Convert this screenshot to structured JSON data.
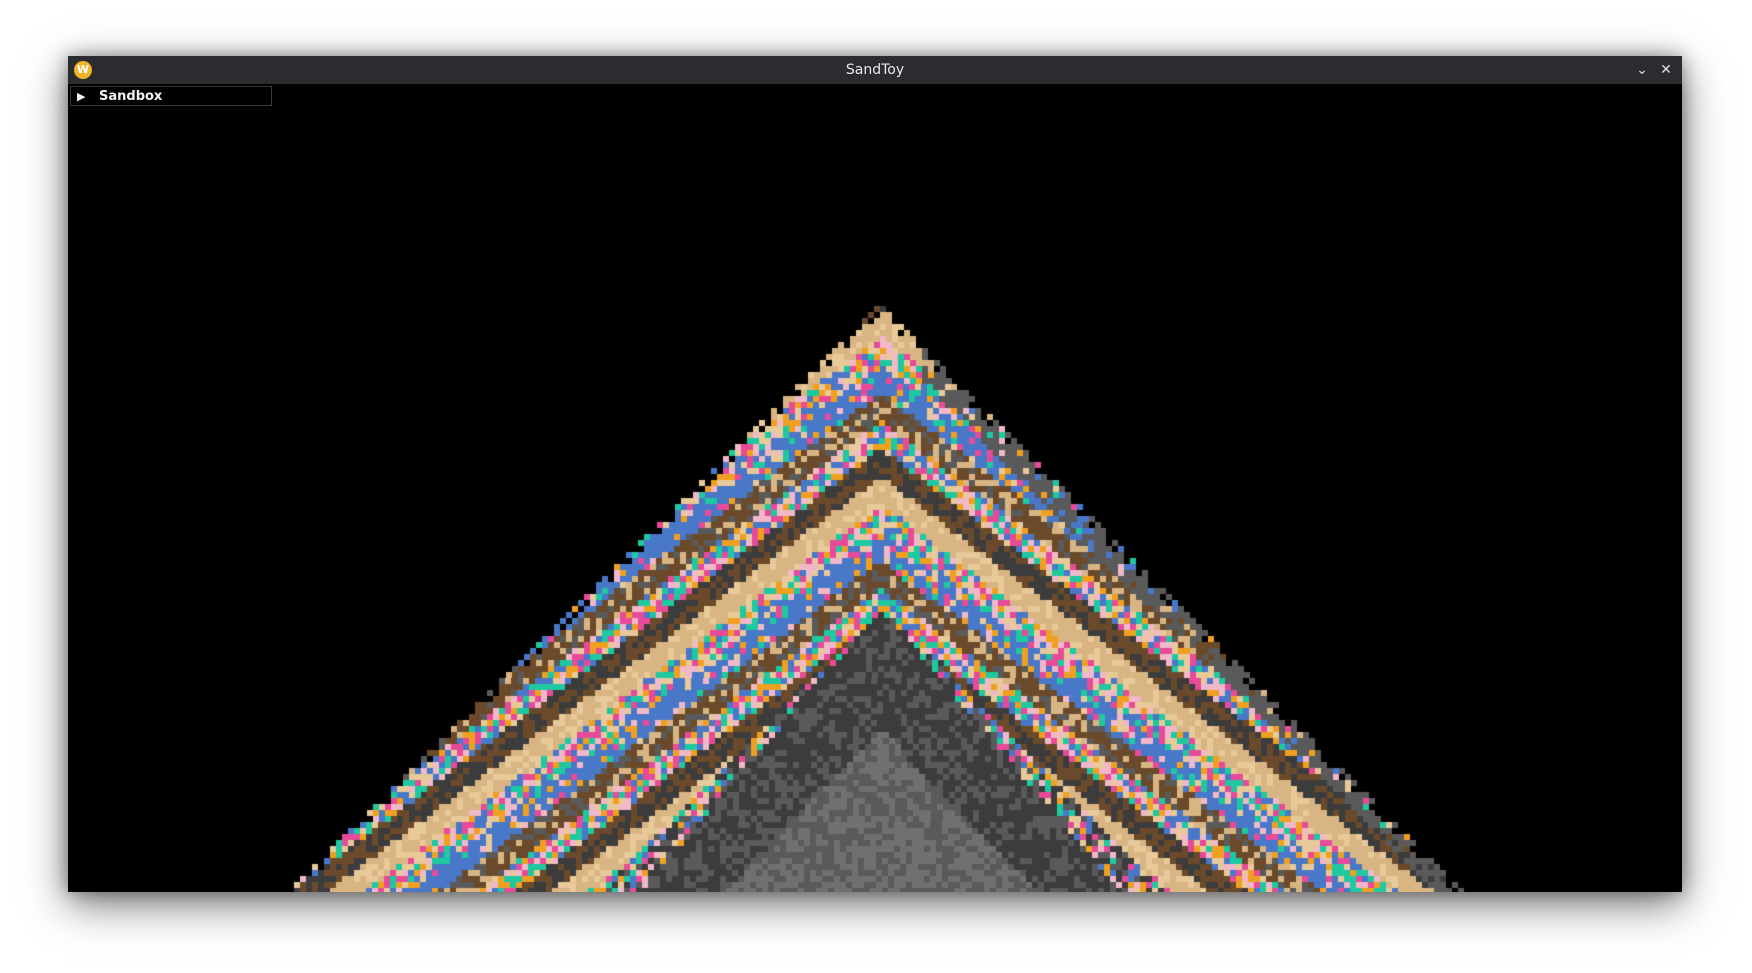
{
  "window": {
    "title": "SandToy",
    "app_icon_letter": "W",
    "minimize_glyph": "⌄",
    "close_glyph": "✕",
    "icons": {
      "app": "app-logo-icon",
      "minimize": "chevron-down-icon",
      "close": "close-icon"
    }
  },
  "panel": {
    "label": "Sandbox",
    "collapse_glyph": "▶",
    "expanded": false
  },
  "sand_palette": {
    "background": "#000000",
    "rock_dark": "#3c3c3c",
    "rock_mid": "#5a5a5a",
    "rock_light": "#707070",
    "sand": "#d8b582",
    "sand_light": "#e8c99a",
    "soil": "#6b4a2b",
    "blue": "#4a78c8",
    "pink": "#e84a9a",
    "teal": "#1ec8a0",
    "orange": "#f0a020",
    "light_pink": "#f0b8c8"
  }
}
